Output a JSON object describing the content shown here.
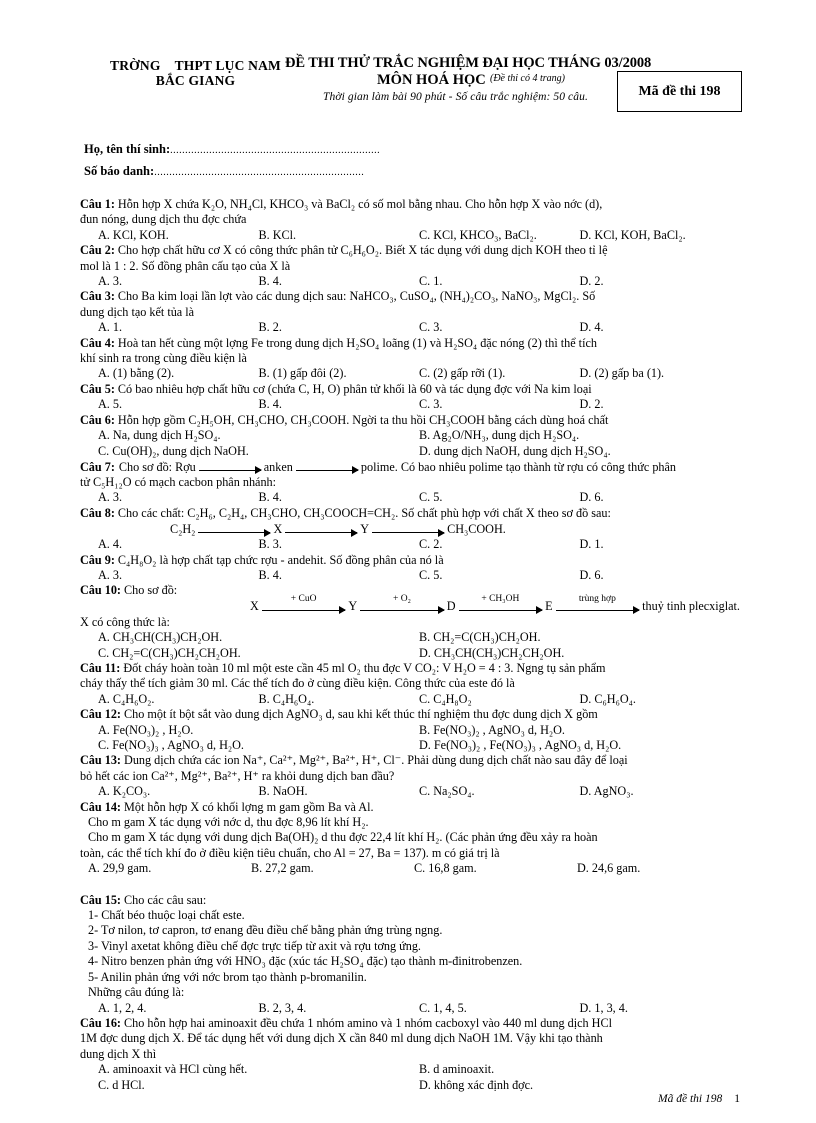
{
  "header": {
    "school_line1": "TRỜNG    THPT LỤC NAM",
    "school_line2": "BẮC GIANG",
    "title_main": "ĐỀ THI THỬ TRẮC NGHIỆM ĐẠI HỌC THÁNG 03/2008",
    "title_sub": "MÔN HOÁ HỌC",
    "title_paren": "(Đề thi có 4 trang)",
    "title_time": "Thời gian làm bài 90 phút - Số câu trắc nghiệm: 50 câu.",
    "exam_code_label": "Mã đề thi 198"
  },
  "identity": {
    "name_label": "Họ, tên thí sinh:",
    "name_dots": "......................................................................",
    "id_label": "Số báo danh:",
    "id_dots": "......................................................................"
  },
  "questions": [
    {
      "num": "Câu 1:",
      "lines": [
        "Hỗn hợp X chứa K₂O, NH₄Cl, KHCO₃ và BaCl₂ có số mol bằng nhau. Cho hỗn hợp X vào nớc   (d),",
        "đun nóng, dung dịch thu đợc  chứa"
      ],
      "opts": [
        "A.  KCl, KOH.",
        "B. KCl.",
        "C. KCl, KHCO₃, BaCl₂.",
        "D. KCl, KOH, BaCl₂."
      ],
      "opt_cols": 4
    },
    {
      "num": "Câu 2:",
      "lines": [
        "Cho hợp chất hữu cơ X có công thức phân tử C₆H₆O₂. Biết X tác dụng  với dung dịch KOH theo tỉ lệ",
        "mol là 1 : 2. Số đồng phân cấu tạo của X là"
      ],
      "opts": [
        "A.  3.",
        "B. 4.",
        "C. 1.",
        "D. 2."
      ],
      "opt_cols": 4
    },
    {
      "num": "Câu 3:",
      "lines": [
        "Cho  Ba kim loại lần lợt   vào các dung dịch sau: NaHCO₃, CuSO₄, (NH₄)₂CO₃, NaNO₃, MgCl₂. Số",
        "dung dịch tạo kết tủa là"
      ],
      "opts": [
        "A. 1.",
        "B. 2.",
        "C. 3.",
        "D. 4."
      ],
      "opt_cols": 4
    },
    {
      "num": "Câu 4:",
      "lines": [
        "Hoà tan hết cùng một lợng   Fe trong dung dịch H₂SO₄ loãng (1) và H₂SO₄ đặc nóng (2) thì thể tích",
        "khí sinh ra trong cùng điều kiện là"
      ],
      "opts": [
        "A.  (1) bằng (2).",
        "B. (1) gấp đôi (2).",
        "C. (2) gấp rỡi   (1).",
        "D.  (2) gấp ba (1)."
      ],
      "opt_cols": 4
    },
    {
      "num": "Câu 5:",
      "lines": [
        "Có bao nhiêu hợp chất hữu cơ (chứa C, H, O) phân tử khối  là 60 và tác dụng đợc   với Na kim loại"
      ],
      "opts": [
        "A.  5.",
        "B. 4.",
        "C. 3.",
        "D. 2."
      ],
      "opt_cols": 4
    },
    {
      "num": "Câu 6:",
      "lines": [
        "Hỗn hợp gồm C₂H₅OH, CH₃CHO, CH₃COOH. Ngời   ta thu hồi CH₃COOH bằng cách dùng hoá chất"
      ],
      "opts": [
        "A. Na, dung dịch H₂SO₄.",
        "B. Ag₂O/NH₃, dung dịch H₂SO₄.",
        "C. Cu(OH)₂, dung dịch NaOH.",
        "D. dung dịch NaOH, dung dịch H₂SO₄."
      ],
      "opt_cols": 2
    },
    {
      "num": "Câu 7:",
      "lines": [
        "Cho  sơ đồ: Rợu       →     anken  →    polime. Có bao nhiêu polime tạo thành từ rợu   có công thức phân",
        "tử C₅H₁₂O có mạch cacbon phân nhánh:"
      ],
      "opts": [
        "A.  3.",
        "B. 4.",
        "C.  5.",
        "D. 6."
      ],
      "opt_cols": 4
    },
    {
      "num": "Câu 8:",
      "lines": [
        "Cho các chất: C₂H₆, C₂H₄, CH₃CHO, CH₃COOCH=CH₂.  Số chất phù hợp  với chất X theo sơ đồ sau:"
      ],
      "opts": [
        "A.  4.",
        "B. 3.",
        "C. 2.",
        "D. 1."
      ],
      "opt_cols": 4
    },
    {
      "num": "Câu 9:",
      "lines": [
        "C₄H₈O₂ là hợp chất tạp chức rợu   - andehit. Số đồng phân của nó là"
      ],
      "opts": [
        "A.  3.",
        "B. 4.",
        "C.  5.",
        "D. 6."
      ],
      "opt_cols": 4
    },
    {
      "num": "Câu 10:",
      "lines": [
        "Cho sơ đồ:"
      ],
      "after_scheme_line": "X có công thức là:",
      "opts": [
        "A. CH₃CH(CH₃)CH₂OH.",
        "B. CH₂=C(CH₃)CH₂OH.",
        "C. CH₂=C(CH₃)CH₂CH₂OH.",
        "D. CH₃CH(CH₃)CH₂CH₂OH."
      ],
      "opt_cols": 2
    },
    {
      "num": "Câu 11:",
      "lines": [
        "Đốt cháy hoàn toàn 10 ml một este cần 45 ml O₂ thu đợc   V CO₂: V H₂O = 4 : 3. Ngng   tụ sản phẩm",
        "cháy thấy thể tích giảm 30 ml. Các thể tích đo ở cùng điều kiện. Công thức của este đó là"
      ],
      "opts": [
        "A.  C₄H₆O₂.",
        "B. C₄H₆O₄.",
        "C. C₄H₈O₂",
        "D. C₆H₆O₄."
      ],
      "opt_cols": 4
    },
    {
      "num": "Câu 12:",
      "lines": [
        "Cho một ít bột sắt vào dung dịch AgNO₃ d,   sau khi kết thúc thí nghiệm thu đợc   dung dịch X gồm"
      ],
      "opts": [
        "A. Fe(NO₃)₂ , H₂O.",
        "B. Fe(NO₃)₂ , AgNO₃ d,   H₂O.",
        "C. Fe(NO₃)₃ , AgNO₃ d,   H₂O.",
        "D. Fe(NO₃)₂ , Fe(NO₃)₃ , AgNO₃ d,   H₂O."
      ],
      "opt_cols": 2
    },
    {
      "num": "Câu 13:",
      "lines": [
        "Dung  dịch chứa các ion Na⁺, Ca²⁺, Mg²⁺, Ba²⁺, H⁺, Cl⁻. Phải dùng dung dịch chất nào sau đây để loại",
        "bỏ hết các ion Ca²⁺, Mg²⁺, Ba²⁺, H⁺ ra khỏi dung dịch ban đầu?"
      ],
      "opts": [
        "A. K₂CO₃.",
        "B. NaOH.",
        "C. Na₂SO₄.",
        "D. AgNO₃."
      ],
      "opt_cols": 4
    },
    {
      "num": "Câu 14:",
      "lines": [
        "Một hỗn hợp X có khối lợng    m gam gồm Ba và Al.",
        "Cho  m gam X tác dụng với nớc   d,   thu đợc   8,96 lít khí H₂.",
        "Cho m gam X tác dụng với dung dịch Ba(OH)₂ d   thu đợc   22,4 lít khí H₂.  (Các phản ứng đều xảy ra hoàn",
        "toàn, các thể tích khí đo ở điều kiện tiêu chuẩn, cho Al = 27, Ba = 137). m có giá trị là"
      ],
      "opts": [
        "A. 29,9 gam.",
        "B. 27,2 gam.",
        "C. 16,8 gam.",
        "D. 24,6 gam."
      ],
      "opt_cols": 4
    },
    {
      "num": "Câu 15:",
      "lines": [
        "Cho các câu sau:",
        "1- Chất béo thuộc  loại chất este.",
        "2- Tơ nilon, tơ capron, tơ enang đều điều chế bằng phản ứng trùng ngng.",
        "3- Vinyl axetat không  điều chế đợc   trực tiếp từ axit và rợu   tơng    ứng.",
        "4- Nitro benzen phản ứng với HNO₃ đặc (xúc tác H₂SO₄ đặc) tạo thành m-đinitrobenzen.",
        "5- Anilin phản ứng với nớc   brom tạo thành p-bromanilin.",
        "Những câu đúng  là:"
      ],
      "opts": [
        "A. 1, 2, 4.",
        "B. 2, 3, 4.",
        "C. 1, 4, 5.",
        "D. 1, 3, 4."
      ],
      "opt_cols": 4
    },
    {
      "num": "Câu 16:",
      "lines": [
        "Cho hỗn hợp hai aminoaxit đều chứa 1 nhóm amino và 1 nhóm cacboxyl vào 440 ml dung dịch HCl",
        "1M đợc   dung dịch X. Để tác dụng hết với dung dịch X cần 840 ml dung dịch NaOH 1M. Vậy khi tạo thành",
        "dung dịch X thì"
      ],
      "opts": [
        "A. aminoaxit  và HCl cùng hết.",
        "B. d   aminoaxit.",
        "C. d   HCl.",
        "D. không xác định đợc."
      ],
      "opt_cols": 2
    }
  ],
  "scheme_q8": {
    "start": "C₂H₂",
    "nodes": [
      "X",
      "Y",
      "CH₃COOH."
    ],
    "arrow_labels": [
      "",
      "",
      ""
    ]
  },
  "scheme_q10": {
    "nodes": [
      "X",
      "Y",
      "D",
      "E",
      "thuỷ tinh plecxiglat."
    ],
    "arrow_labels": [
      "+ CuO",
      "+ O₂",
      "+ CH₃OH",
      "trùng hợp"
    ]
  },
  "scheme_q7": {
    "text": "Rợu       anken        polime."
  },
  "footer": {
    "code": "Mã đề thi 198",
    "page": "1"
  }
}
